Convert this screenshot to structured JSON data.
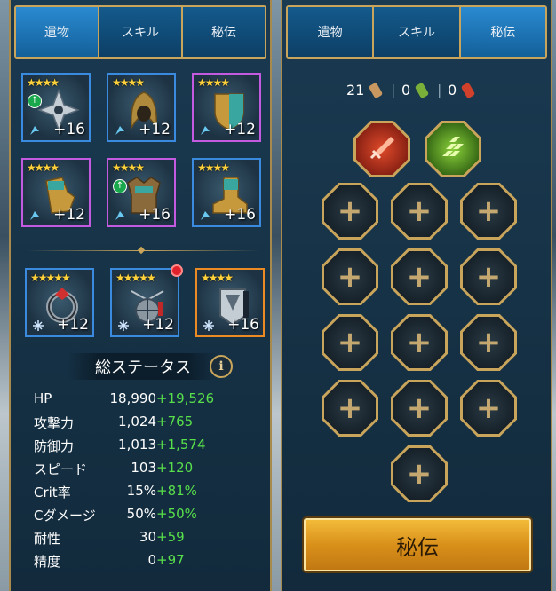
{
  "left": {
    "tabs": [
      {
        "label": "遺物",
        "active": true
      },
      {
        "label": "スキル",
        "active": false
      },
      {
        "label": "秘伝",
        "active": false
      }
    ],
    "artifacts": [
      {
        "stars": "★★★★",
        "level": "+16",
        "rarity": "blue",
        "upgrade": true,
        "icon": "shuriken-weapon-icon"
      },
      {
        "stars": "★★★★",
        "level": "+12",
        "rarity": "blue",
        "upgrade": false,
        "icon": "hood-helmet-icon"
      },
      {
        "stars": "★★★★",
        "level": "+12",
        "rarity": "purple",
        "upgrade": false,
        "icon": "shield-icon"
      },
      {
        "stars": "★★★★",
        "level": "+12",
        "rarity": "purple",
        "upgrade": false,
        "icon": "gloves-icon"
      },
      {
        "stars": "★★★★",
        "level": "+16",
        "rarity": "purple",
        "upgrade": true,
        "icon": "chest-armor-icon"
      },
      {
        "stars": "★★★★",
        "level": "+16",
        "rarity": "blue",
        "upgrade": false,
        "icon": "boots-icon"
      }
    ],
    "accessories": [
      {
        "stars": "★★★★★",
        "level": "+12",
        "rarity": "blue",
        "icon": "ring-icon",
        "alert": false
      },
      {
        "stars": "★★★★★",
        "level": "+12",
        "rarity": "blue",
        "icon": "amulet-icon",
        "alert": true
      },
      {
        "stars": "★★★★",
        "level": "+16",
        "rarity": "orange",
        "icon": "banner-icon",
        "alert": false
      }
    ],
    "stats_title": "総ステータス",
    "info_label": "i",
    "stats": [
      {
        "label": "HP",
        "base": "18,990",
        "bonus": "+19,526"
      },
      {
        "label": "攻撃力",
        "base": "1,024",
        "bonus": "+765"
      },
      {
        "label": "防御力",
        "base": "1,013",
        "bonus": "+1,574"
      },
      {
        "label": "スピード",
        "base": "103",
        "bonus": "+120"
      },
      {
        "label": "Crit率",
        "base": "15%",
        "bonus": "+81%"
      },
      {
        "label": "Cダメージ",
        "base": "50%",
        "bonus": "+50%"
      },
      {
        "label": "耐性",
        "base": "30",
        "bonus": "+59"
      },
      {
        "label": "精度",
        "base": "0",
        "bonus": "+97"
      }
    ]
  },
  "right": {
    "tabs": [
      {
        "label": "遺物",
        "active": false
      },
      {
        "label": "スキル",
        "active": false
      },
      {
        "label": "秘伝",
        "active": true
      }
    ],
    "currency": [
      {
        "value": "21",
        "icon": "bronze-scroll-icon"
      },
      {
        "value": "0",
        "icon": "green-scroll-icon"
      },
      {
        "value": "0",
        "icon": "red-scroll-icon"
      }
    ],
    "categories": [
      {
        "icon": "offense-sword-icon",
        "color": "#c8301c"
      },
      {
        "icon": "support-blocks-icon",
        "color": "#5aa81c"
      }
    ],
    "empty_slot_count": 13,
    "action_button": "秘伝"
  },
  "colors": {
    "accent_gold": "#c9a55c",
    "tab_blue": "#145a8c",
    "bonus_green": "#58e04a",
    "button_orange": "#e0a02a"
  }
}
